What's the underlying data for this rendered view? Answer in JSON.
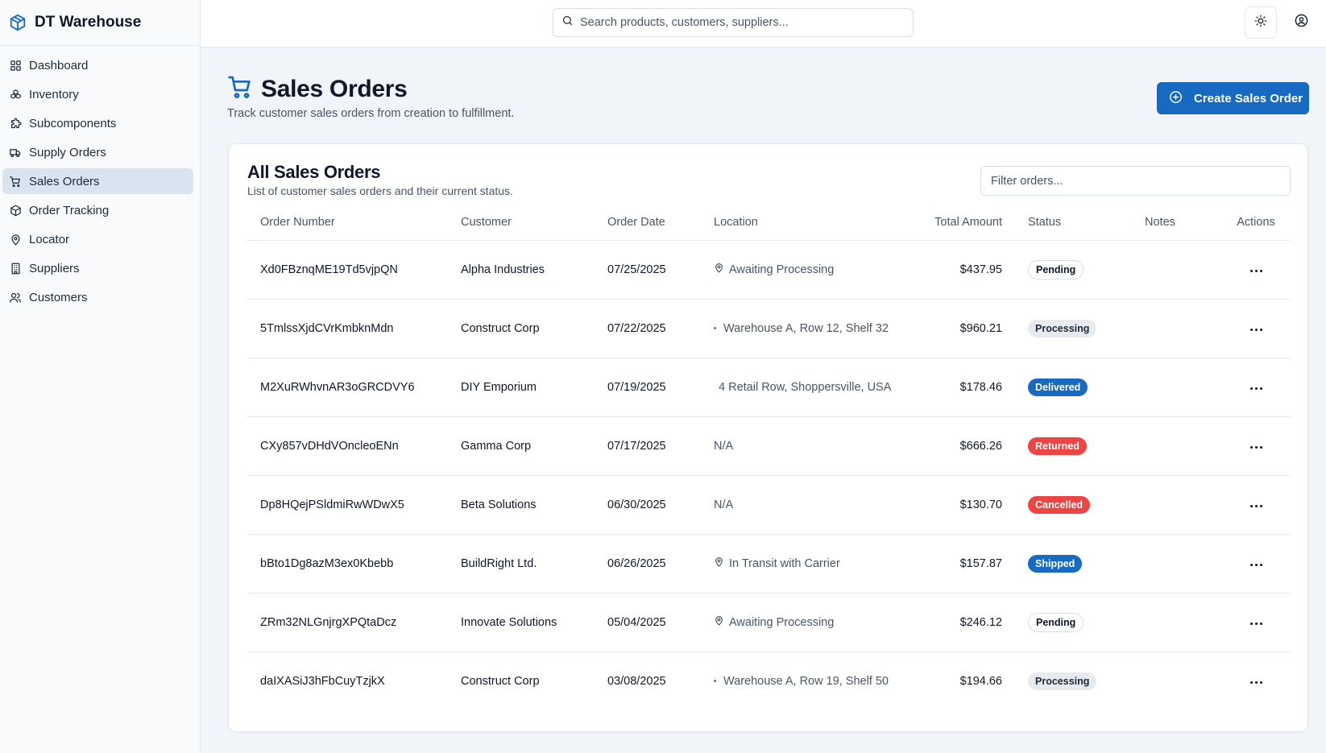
{
  "app": {
    "name": "DT Warehouse"
  },
  "sidebar": {
    "items": [
      {
        "label": "Dashboard",
        "icon": "grid-icon",
        "active": false
      },
      {
        "label": "Inventory",
        "icon": "boxes-icon",
        "active": false
      },
      {
        "label": "Subcomponents",
        "icon": "puzzle-icon",
        "active": false
      },
      {
        "label": "Supply Orders",
        "icon": "truck-icon",
        "active": false
      },
      {
        "label": "Sales Orders",
        "icon": "cart-icon",
        "active": true
      },
      {
        "label": "Order Tracking",
        "icon": "package-icon",
        "active": false
      },
      {
        "label": "Locator",
        "icon": "map-pin-icon",
        "active": false
      },
      {
        "label": "Suppliers",
        "icon": "building-icon",
        "active": false
      },
      {
        "label": "Customers",
        "icon": "users-icon",
        "active": false
      }
    ]
  },
  "header": {
    "search_placeholder": "Search products, customers, suppliers..."
  },
  "page": {
    "title": "Sales Orders",
    "subtitle": "Track customer sales orders from creation to fulfillment.",
    "create_label": "Create Sales Order"
  },
  "card": {
    "title": "All Sales Orders",
    "subtitle": "List of customer sales orders and their current status.",
    "filter_placeholder": "Filter orders..."
  },
  "table": {
    "columns": [
      "Order Number",
      "Customer",
      "Order Date",
      "Location",
      "Total Amount",
      "Status",
      "Notes",
      "Actions"
    ],
    "rows": [
      {
        "order": "Xd0FBznqME19Td5vjpQN",
        "customer": "Alpha Industries",
        "date": "07/25/2025",
        "location": "Awaiting Processing",
        "loc_icon": "pin",
        "amount": "$437.95",
        "status": "Pending",
        "status_kind": "pending",
        "notes": ""
      },
      {
        "order": "5TmlssXjdCVrKmbknMdn",
        "customer": "Construct Corp",
        "date": "07/22/2025",
        "location": "Warehouse A, Row 12, Shelf 32",
        "loc_icon": "dot",
        "amount": "$960.21",
        "status": "Processing",
        "status_kind": "processing",
        "notes": ""
      },
      {
        "order": "M2XuRWhvnAR3oGRCDVY6",
        "customer": "DIY Emporium",
        "date": "07/19/2025",
        "location": "4 Retail Row, Shoppersville, USA",
        "loc_icon": "blank",
        "amount": "$178.46",
        "status": "Delivered",
        "status_kind": "delivered",
        "notes": ""
      },
      {
        "order": "CXy857vDHdVOncleoENn",
        "customer": "Gamma Corp",
        "date": "07/17/2025",
        "location": "N/A",
        "loc_icon": "none",
        "amount": "$666.26",
        "status": "Returned",
        "status_kind": "returned",
        "notes": ""
      },
      {
        "order": "Dp8HQejPSldmiRwWDwX5",
        "customer": "Beta Solutions",
        "date": "06/30/2025",
        "location": "N/A",
        "loc_icon": "none",
        "amount": "$130.70",
        "status": "Cancelled",
        "status_kind": "cancelled",
        "notes": ""
      },
      {
        "order": "bBto1Dg8azM3ex0Kbebb",
        "customer": "BuildRight Ltd.",
        "date": "06/26/2025",
        "location": "In Transit with Carrier",
        "loc_icon": "pin",
        "amount": "$157.87",
        "status": "Shipped",
        "status_kind": "shipped",
        "notes": ""
      },
      {
        "order": "ZRm32NLGnjrgXPQtaDcz",
        "customer": "Innovate Solutions",
        "date": "05/04/2025",
        "location": "Awaiting Processing",
        "loc_icon": "pin",
        "amount": "$246.12",
        "status": "Pending",
        "status_kind": "pending",
        "notes": ""
      },
      {
        "order": "daIXASiJ3hFbCuyTzjkX",
        "customer": "Construct Corp",
        "date": "03/08/2025",
        "location": "Warehouse A, Row 19, Shelf 50",
        "loc_icon": "dot",
        "amount": "$194.66",
        "status": "Processing",
        "status_kind": "processing",
        "notes": ""
      }
    ]
  },
  "colors": {
    "accent": "#1769c2",
    "danger": "#ef4444",
    "active_nav": "#d9e4f0"
  }
}
